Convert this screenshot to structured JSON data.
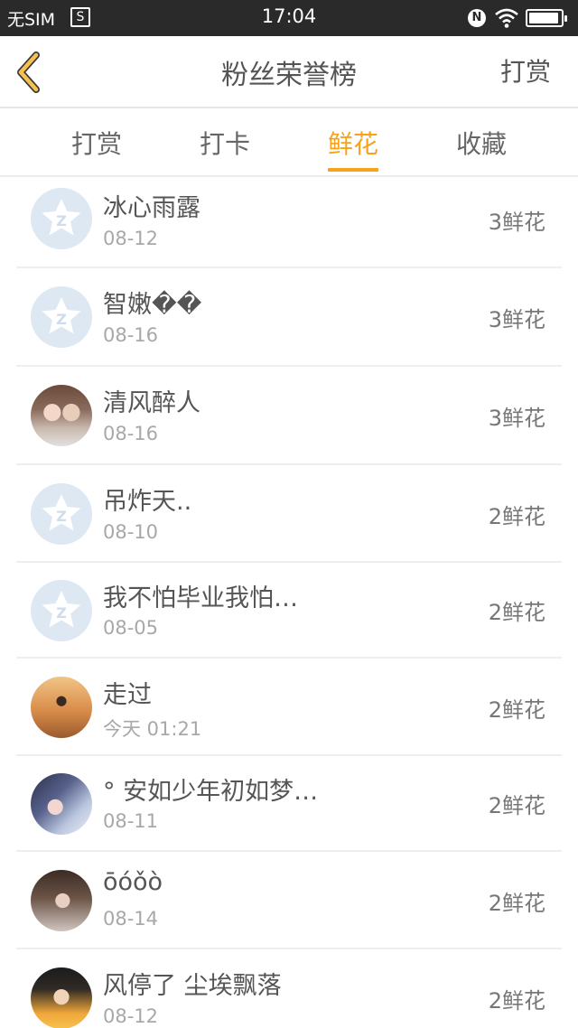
{
  "status_bar": {
    "sim": "无SIM",
    "sim_icon": "sim-icon",
    "sim_icon_glyph": "S",
    "time": "17:04",
    "nfc": "N",
    "battery_level": 0.95
  },
  "navbar": {
    "title": "粉丝荣誉榜",
    "right_action": "打赏",
    "back_icon": "chevron-left-icon"
  },
  "colors": {
    "accent": "#f6a21b",
    "divider": "#eeeeee"
  },
  "tabs": [
    {
      "label": "打赏",
      "active": false
    },
    {
      "label": "打卡",
      "active": false
    },
    {
      "label": "鲜花",
      "active": true
    },
    {
      "label": "收藏",
      "active": false
    }
  ],
  "fans": [
    {
      "name": "冰心雨露",
      "date": "08-12",
      "amount": "3鲜花",
      "avatar": "default"
    },
    {
      "name": "智嫩��",
      "date": "08-16",
      "amount": "3鲜花",
      "avatar": "default"
    },
    {
      "name": "清风醉人",
      "date": "08-16",
      "amount": "3鲜花",
      "avatar": "photo"
    },
    {
      "name": "吊炸天..",
      "date": "08-10",
      "amount": "2鲜花",
      "avatar": "default"
    },
    {
      "name": "我不怕毕业我怕…",
      "date": "08-05",
      "amount": "2鲜花",
      "avatar": "default"
    },
    {
      "name": "走过",
      "date": "今天 01:21",
      "amount": "2鲜花",
      "avatar": "photo"
    },
    {
      "name": "° 安如少年初如梦…",
      "date": "08-11",
      "amount": "2鲜花",
      "avatar": "photo"
    },
    {
      "name": "ōóǒò",
      "date": "08-14",
      "amount": "2鲜花",
      "avatar": "photo"
    },
    {
      "name": "风停了 尘埃飘落",
      "date": "08-12",
      "amount": "2鲜花",
      "avatar": "photo"
    }
  ]
}
